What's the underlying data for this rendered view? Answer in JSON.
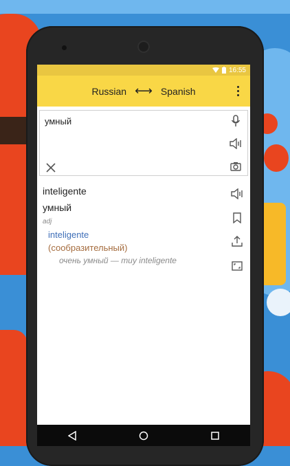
{
  "status": {
    "time": "16:55"
  },
  "appbar": {
    "source_lang": "Russian",
    "arrow": "⟷",
    "target_lang": "Spanish"
  },
  "input": {
    "value": "умный"
  },
  "result": {
    "translation": "inteligente",
    "source_word": "умный",
    "part_of_speech": "adj",
    "translation_link": "inteligente",
    "synonym": "(сообразительный)",
    "example": "очень умный — muy inteligente"
  },
  "colors": {
    "appbar": "#f9d746",
    "translation": "#3f6fb8",
    "synonym": "#a56c3e"
  },
  "icons": [
    "mic-icon",
    "speaker-icon",
    "clear-icon",
    "camera-icon",
    "bookmark-icon",
    "share-icon",
    "fullscreen-icon",
    "back-icon",
    "home-icon",
    "recents-icon"
  ]
}
